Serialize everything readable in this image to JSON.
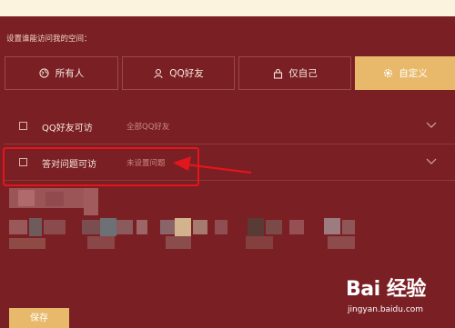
{
  "section_label": "设置谁能访问我的空间：",
  "tabs": [
    {
      "label": "所有人",
      "icon": "globe-icon",
      "active": false
    },
    {
      "label": "QQ好友",
      "icon": "friends-icon",
      "active": false
    },
    {
      "label": "仅自己",
      "icon": "lock-icon",
      "active": false
    },
    {
      "label": "自定义",
      "icon": "gear-icon",
      "active": true
    }
  ],
  "options": [
    {
      "label": "QQ好友可访",
      "hint": "全部QQ好友",
      "checked": false
    },
    {
      "label": "答对问题可访",
      "hint": "未设置问题",
      "checked": false
    }
  ],
  "save_label": "保存",
  "watermark": {
    "logo": "Bai 经验",
    "url": "jingyan.baidu.com"
  },
  "colors": {
    "background": "#7a1f24",
    "accent": "#e8b96b",
    "annotation": "#e3151d"
  }
}
